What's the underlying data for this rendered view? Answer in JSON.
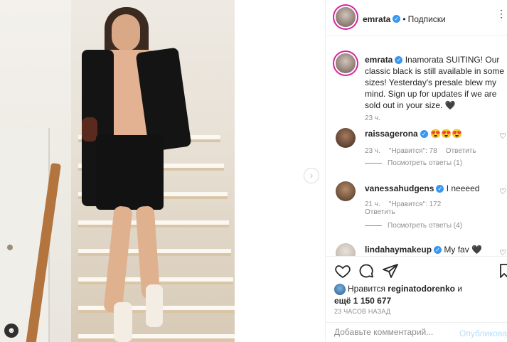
{
  "header": {
    "username": "emrata",
    "separator": "•",
    "follow_label": "Подписки"
  },
  "caption": {
    "username": "emrata",
    "text": "Inamorata SUITING! Our classic black is still available in some sizes! Yesterday's presale blew my mind. Sign up for updates if we are sold out in your size. 🖤",
    "time": "23 ч."
  },
  "comments": [
    {
      "username": "raissagerona",
      "text": "😍😍😍",
      "time": "23 ч.",
      "likes": "\"Нравится\": 78",
      "reply": "Ответить",
      "view_replies": "Посмотреть ответы (1)"
    },
    {
      "username": "vanessahudgens",
      "text": "I neeeed",
      "time": "21 ч.",
      "likes": "\"Нравится\": 172",
      "reply": "Ответить",
      "view_replies": "Посмотреть ответы (4)"
    },
    {
      "username": "lindahaymakeup",
      "text": "My fav 🖤"
    }
  ],
  "likes": {
    "prefix": "Нравится",
    "user": "reginatodorenko",
    "conj": "и",
    "more": "ещё 1 150 677"
  },
  "post_time": "23 ЧАСОВ НАЗАД",
  "add_comment": {
    "placeholder": "Добавьте комментарий...",
    "publish_label": "Опубликовать"
  },
  "colors": {
    "verified": "#3897f0",
    "publish_disabled": "#b2dffc",
    "muted": "#8e8e8e"
  }
}
